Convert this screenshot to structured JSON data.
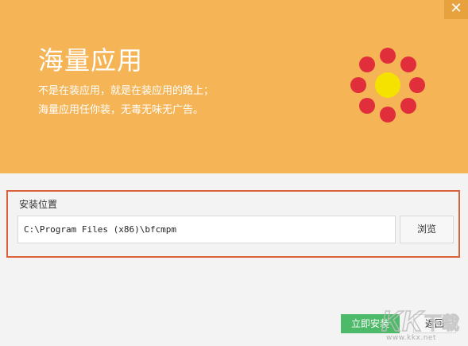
{
  "window": {
    "close_glyph": "✕"
  },
  "banner": {
    "title": "海量应用",
    "tagline_1": "不是在装应用，就是在装应用的路上；",
    "tagline_2": "海量应用任你装，无毒无味无广告。",
    "background_color": "#f5b556",
    "logo": {
      "icon": "flower-dots-logo",
      "dot_color": "#e02f3b",
      "center_color": "#f5e200"
    }
  },
  "install_location": {
    "label": "安装位置",
    "path_value": "C:\\Program Files (x86)\\bfcmpm",
    "browse_label": "浏览",
    "highlight_color": "#d9633a"
  },
  "footer": {
    "install_label": "立即安装",
    "back_label": "返回",
    "install_color": "#4cba68"
  },
  "watermark": {
    "logo_text": "KK下载",
    "url_text": "www.kkx.net"
  }
}
